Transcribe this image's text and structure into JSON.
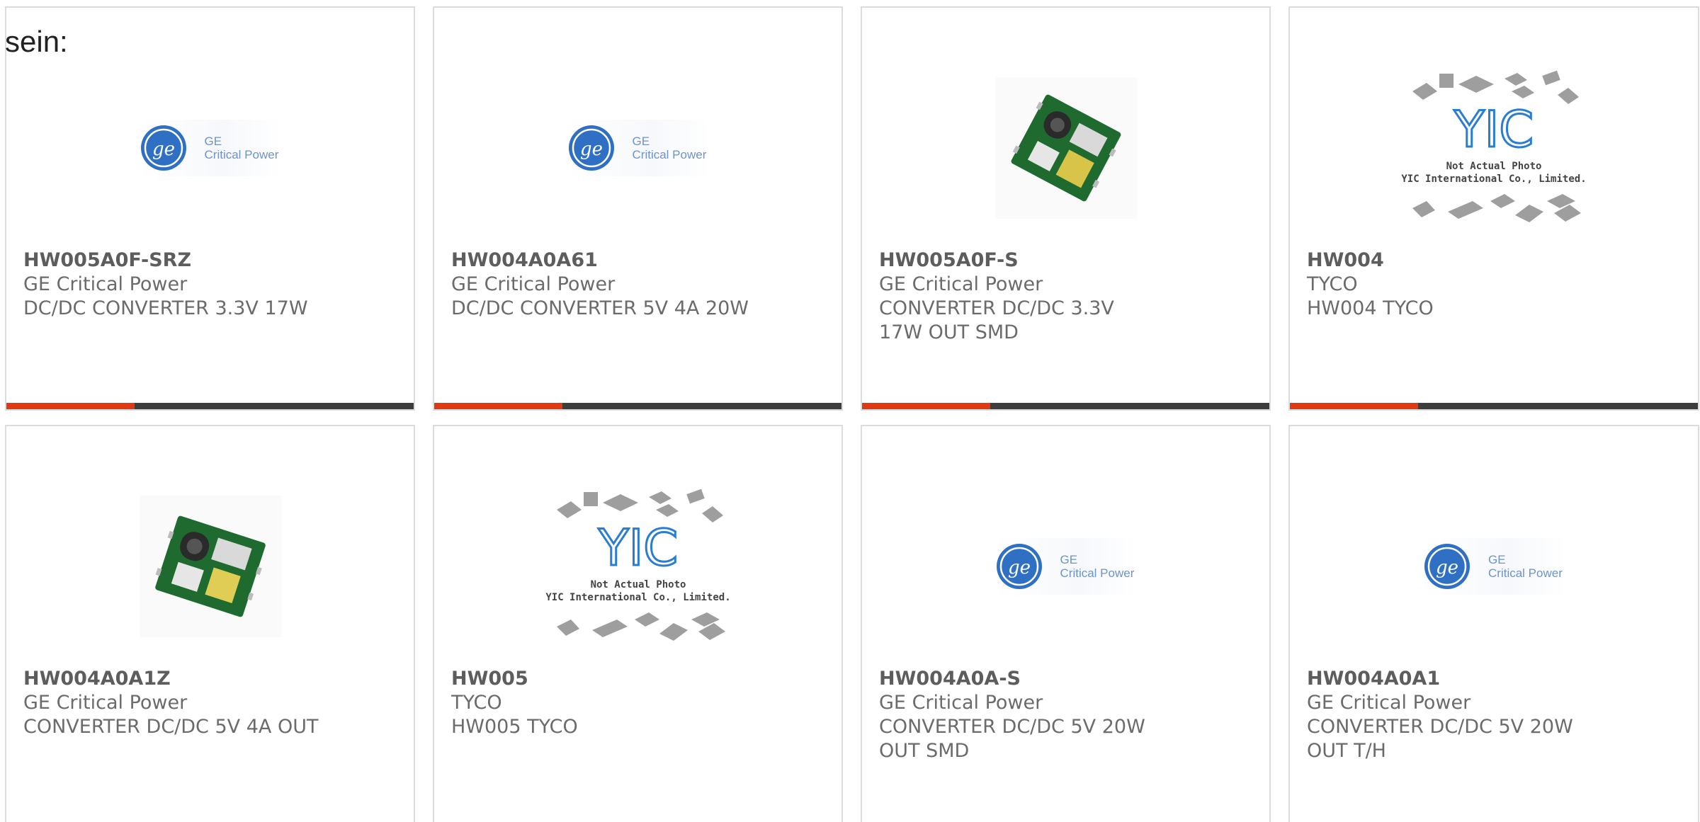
{
  "intro_text": "sein:",
  "colors": {
    "accent": "#e03a12",
    "bar": "#3d3d3d",
    "card_border": "#dcdcdc",
    "text": "#6b6b6b"
  },
  "products": [
    {
      "part": "HW005A0F-SRZ",
      "maker": "GE Critical Power",
      "desc": "DC/DC CONVERTER 3.3V 17W",
      "image": "ge-critical-power-logo"
    },
    {
      "part": "HW004A0A61",
      "maker": "GE Critical Power",
      "desc": "DC/DC CONVERTER 5V 4A 20W",
      "image": "ge-critical-power-logo"
    },
    {
      "part": "HW005A0F-S",
      "maker": "GE Critical Power",
      "desc": "CONVERTER DC/DC 3.3V 17W OUT SMD",
      "image": "converter-board-photo"
    },
    {
      "part": "HW004",
      "maker": "TYCO",
      "desc": "HW004 TYCO",
      "image": "yic-not-actual-photo"
    },
    {
      "part": "HW004A0A1Z",
      "maker": "GE Critical Power",
      "desc": "CONVERTER DC/DC 5V 4A OUT",
      "image": "converter-board-photo"
    },
    {
      "part": "HW005",
      "maker": "TYCO",
      "desc": "HW005 TYCO",
      "image": "yic-not-actual-photo"
    },
    {
      "part": "HW004A0A-S",
      "maker": "GE Critical Power",
      "desc": "CONVERTER DC/DC 5V 20W OUT SMD",
      "image": "ge-critical-power-logo"
    },
    {
      "part": "HW004A0A1",
      "maker": "GE Critical Power",
      "desc": "CONVERTER DC/DC 5V 20W OUT T/H",
      "image": "ge-critical-power-logo"
    }
  ],
  "logo_text": {
    "ge_line1": "GE",
    "ge_line2": "Critical Power",
    "yic_mark": "YIC",
    "yic_line1": "Not Actual Photo",
    "yic_line2": "YIC International Co., Limited."
  }
}
